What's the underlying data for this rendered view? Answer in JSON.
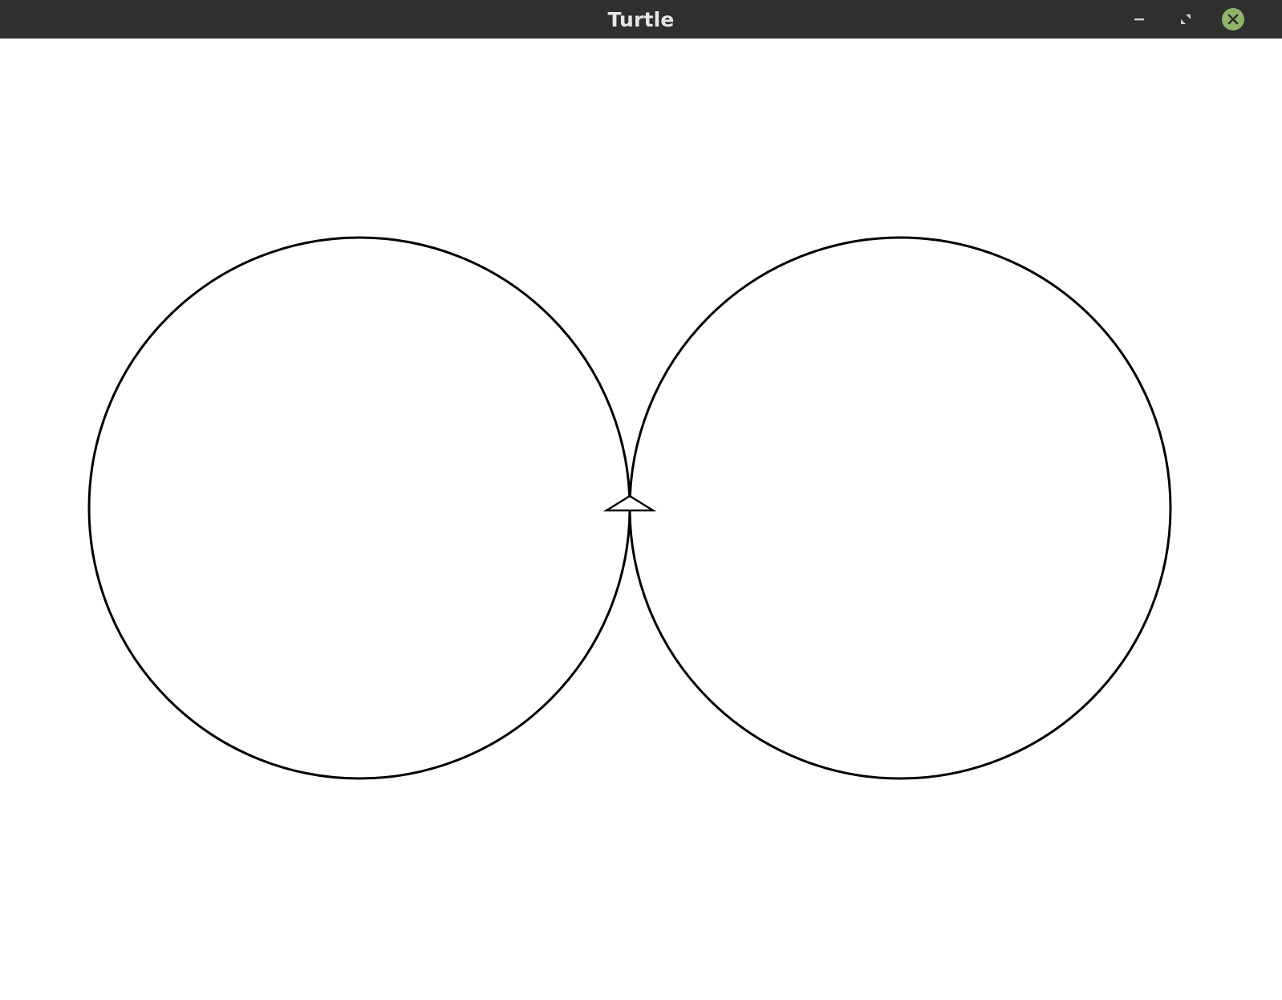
{
  "window": {
    "title": "Turtle",
    "controls": {
      "minimize_icon": "minimize-icon",
      "maximize_icon": "restore-icon",
      "close_icon": "close-icon"
    },
    "colors": {
      "titlebar": "#2f2f2f",
      "title_text": "#e6e6e6",
      "close_button": "#8fb36b",
      "canvas": "#ffffff",
      "pen": "#000000"
    }
  },
  "turtle": {
    "shape": "classic",
    "heading": "up"
  }
}
